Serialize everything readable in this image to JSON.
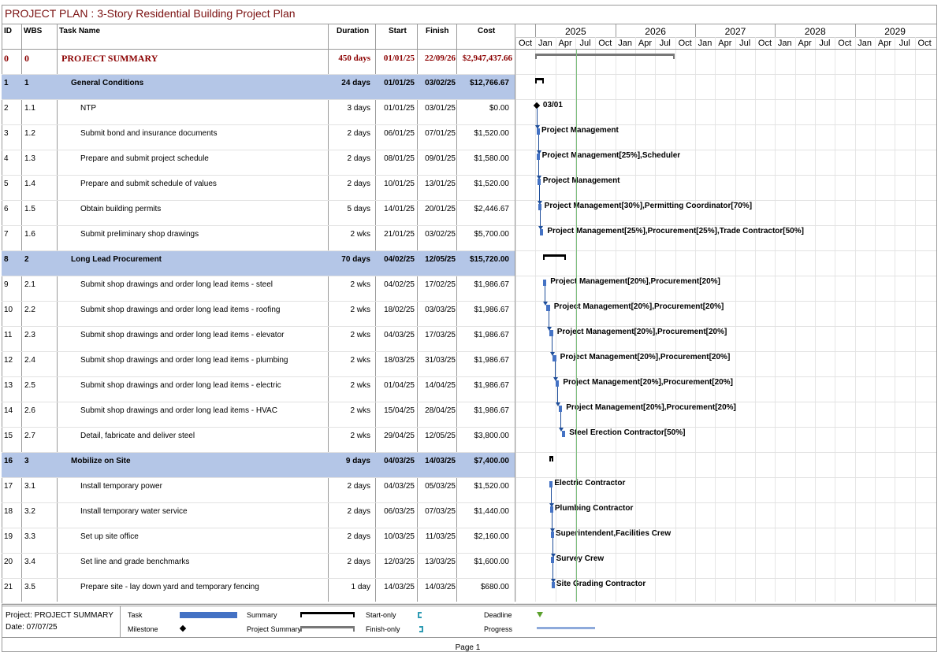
{
  "title": "PROJECT PLAN : 3-Story Residential Building Project Plan",
  "columns": {
    "id": "ID",
    "wbs": "WBS",
    "name": "Task Name",
    "duration": "Duration",
    "start": "Start",
    "finish": "Finish",
    "cost": "Cost"
  },
  "timeline": {
    "years": [
      "2025",
      "2026",
      "2027",
      "2028",
      "2029"
    ],
    "months": [
      "Oct",
      "Jan",
      "Apr",
      "Jul",
      "Oct",
      "Jan",
      "Apr",
      "Jul",
      "Oct",
      "Jan",
      "Apr",
      "Jul",
      "Oct",
      "Jan",
      "Apr",
      "Jul",
      "Oct",
      "Jan",
      "Apr",
      "Jul",
      "Oct"
    ]
  },
  "tasks": [
    {
      "id": "0",
      "wbs": "0",
      "name": "PROJECT SUMMARY",
      "duration": "450 days",
      "start": "01/01/25",
      "finish": "22/09/26",
      "cost": "$2,947,437.66",
      "type": "project",
      "label": ""
    },
    {
      "id": "1",
      "wbs": "1",
      "name": "General Conditions",
      "duration": "24 days",
      "start": "01/01/25",
      "finish": "03/02/25",
      "cost": "$12,766.67",
      "type": "summary",
      "label": ""
    },
    {
      "id": "2",
      "wbs": "1.1",
      "name": "NTP",
      "duration": "3 days",
      "start": "01/01/25",
      "finish": "03/01/25",
      "cost": "$0.00",
      "type": "milestone",
      "label": "03/01"
    },
    {
      "id": "3",
      "wbs": "1.2",
      "name": "Submit bond and insurance documents",
      "duration": "2 days",
      "start": "06/01/25",
      "finish": "07/01/25",
      "cost": "$1,520.00",
      "type": "task",
      "label": "Project Management"
    },
    {
      "id": "4",
      "wbs": "1.3",
      "name": "Prepare and submit project schedule",
      "duration": "2 days",
      "start": "08/01/25",
      "finish": "09/01/25",
      "cost": "$1,580.00",
      "type": "task",
      "label": "Project Management[25%],Scheduler"
    },
    {
      "id": "5",
      "wbs": "1.4",
      "name": "Prepare and submit schedule of values",
      "duration": "2 days",
      "start": "10/01/25",
      "finish": "13/01/25",
      "cost": "$1,520.00",
      "type": "task",
      "label": "Project Management"
    },
    {
      "id": "6",
      "wbs": "1.5",
      "name": "Obtain building permits",
      "duration": "5 days",
      "start": "14/01/25",
      "finish": "20/01/25",
      "cost": "$2,446.67",
      "type": "task",
      "label": "Project Management[30%],Permitting Coordinator[70%]"
    },
    {
      "id": "7",
      "wbs": "1.6",
      "name": "Submit preliminary shop drawings",
      "duration": "2 wks",
      "start": "21/01/25",
      "finish": "03/02/25",
      "cost": "$5,700.00",
      "type": "task",
      "label": "Project Management[25%],Procurement[25%],Trade Contractor[50%]"
    },
    {
      "id": "8",
      "wbs": "2",
      "name": "Long Lead Procurement",
      "duration": "70 days",
      "start": "04/02/25",
      "finish": "12/05/25",
      "cost": "$15,720.00",
      "type": "summary",
      "label": ""
    },
    {
      "id": "9",
      "wbs": "2.1",
      "name": "Submit shop drawings and order long lead items - steel",
      "duration": "2 wks",
      "start": "04/02/25",
      "finish": "17/02/25",
      "cost": "$1,986.67",
      "type": "task",
      "label": "Project Management[20%],Procurement[20%]"
    },
    {
      "id": "10",
      "wbs": "2.2",
      "name": "Submit shop drawings and order long lead items - roofing",
      "duration": "2 wks",
      "start": "18/02/25",
      "finish": "03/03/25",
      "cost": "$1,986.67",
      "type": "task",
      "label": "Project Management[20%],Procurement[20%]"
    },
    {
      "id": "11",
      "wbs": "2.3",
      "name": "Submit shop drawings and order long lead items - elevator",
      "duration": "2 wks",
      "start": "04/03/25",
      "finish": "17/03/25",
      "cost": "$1,986.67",
      "type": "task",
      "label": "Project Management[20%],Procurement[20%]"
    },
    {
      "id": "12",
      "wbs": "2.4",
      "name": "Submit shop drawings and order long lead items - plumbing",
      "duration": "2 wks",
      "start": "18/03/25",
      "finish": "31/03/25",
      "cost": "$1,986.67",
      "type": "task",
      "label": "Project Management[20%],Procurement[20%]"
    },
    {
      "id": "13",
      "wbs": "2.5",
      "name": "Submit shop drawings and order long lead items - electric",
      "duration": "2 wks",
      "start": "01/04/25",
      "finish": "14/04/25",
      "cost": "$1,986.67",
      "type": "task",
      "label": "Project Management[20%],Procurement[20%]"
    },
    {
      "id": "14",
      "wbs": "2.6",
      "name": "Submit shop drawings and order long lead items - HVAC",
      "duration": "2 wks",
      "start": "15/04/25",
      "finish": "28/04/25",
      "cost": "$1,986.67",
      "type": "task",
      "label": "Project Management[20%],Procurement[20%]"
    },
    {
      "id": "15",
      "wbs": "2.7",
      "name": "Detail, fabricate and deliver steel",
      "duration": "2 wks",
      "start": "29/04/25",
      "finish": "12/05/25",
      "cost": "$3,800.00",
      "type": "task",
      "label": "Steel Erection Contractor[50%]"
    },
    {
      "id": "16",
      "wbs": "3",
      "name": "Mobilize on Site",
      "duration": "9 days",
      "start": "04/03/25",
      "finish": "14/03/25",
      "cost": "$7,400.00",
      "type": "summary",
      "label": ""
    },
    {
      "id": "17",
      "wbs": "3.1",
      "name": "Install temporary power",
      "duration": "2 days",
      "start": "04/03/25",
      "finish": "05/03/25",
      "cost": "$1,520.00",
      "type": "task",
      "label": "Electric Contractor"
    },
    {
      "id": "18",
      "wbs": "3.2",
      "name": "Install temporary water service",
      "duration": "2 days",
      "start": "06/03/25",
      "finish": "07/03/25",
      "cost": "$1,440.00",
      "type": "task",
      "label": "Plumbing Contractor"
    },
    {
      "id": "19",
      "wbs": "3.3",
      "name": "Set up site office",
      "duration": "2 days",
      "start": "10/03/25",
      "finish": "11/03/25",
      "cost": "$2,160.00",
      "type": "task",
      "label": "Superintendent,Facilities Crew"
    },
    {
      "id": "20",
      "wbs": "3.4",
      "name": "Set line and grade benchmarks",
      "duration": "2 days",
      "start": "12/03/25",
      "finish": "13/03/25",
      "cost": "$1,600.00",
      "type": "task",
      "label": "Survey Crew"
    },
    {
      "id": "21",
      "wbs": "3.5",
      "name": "Prepare site - lay down yard and temporary fencing",
      "duration": "1 day",
      "start": "14/03/25",
      "finish": "14/03/25",
      "cost": "$680.00",
      "type": "task",
      "label": "Site Grading Contractor"
    }
  ],
  "legend": {
    "project": "Project: PROJECT SUMMARY",
    "date": "Date: 07/07/25",
    "task": "Task",
    "milestone": "Milestone",
    "summary": "Summary",
    "project_summary": "Project Summary",
    "start_only": "Start-only",
    "finish_only": "Finish-only",
    "deadline": "Deadline",
    "progress": "Progress"
  },
  "colors": {
    "summary_row": "#b4c6e7",
    "task_bar": "#4472c4",
    "title": "#7a1010"
  },
  "footer": {
    "page": "Page 1"
  }
}
